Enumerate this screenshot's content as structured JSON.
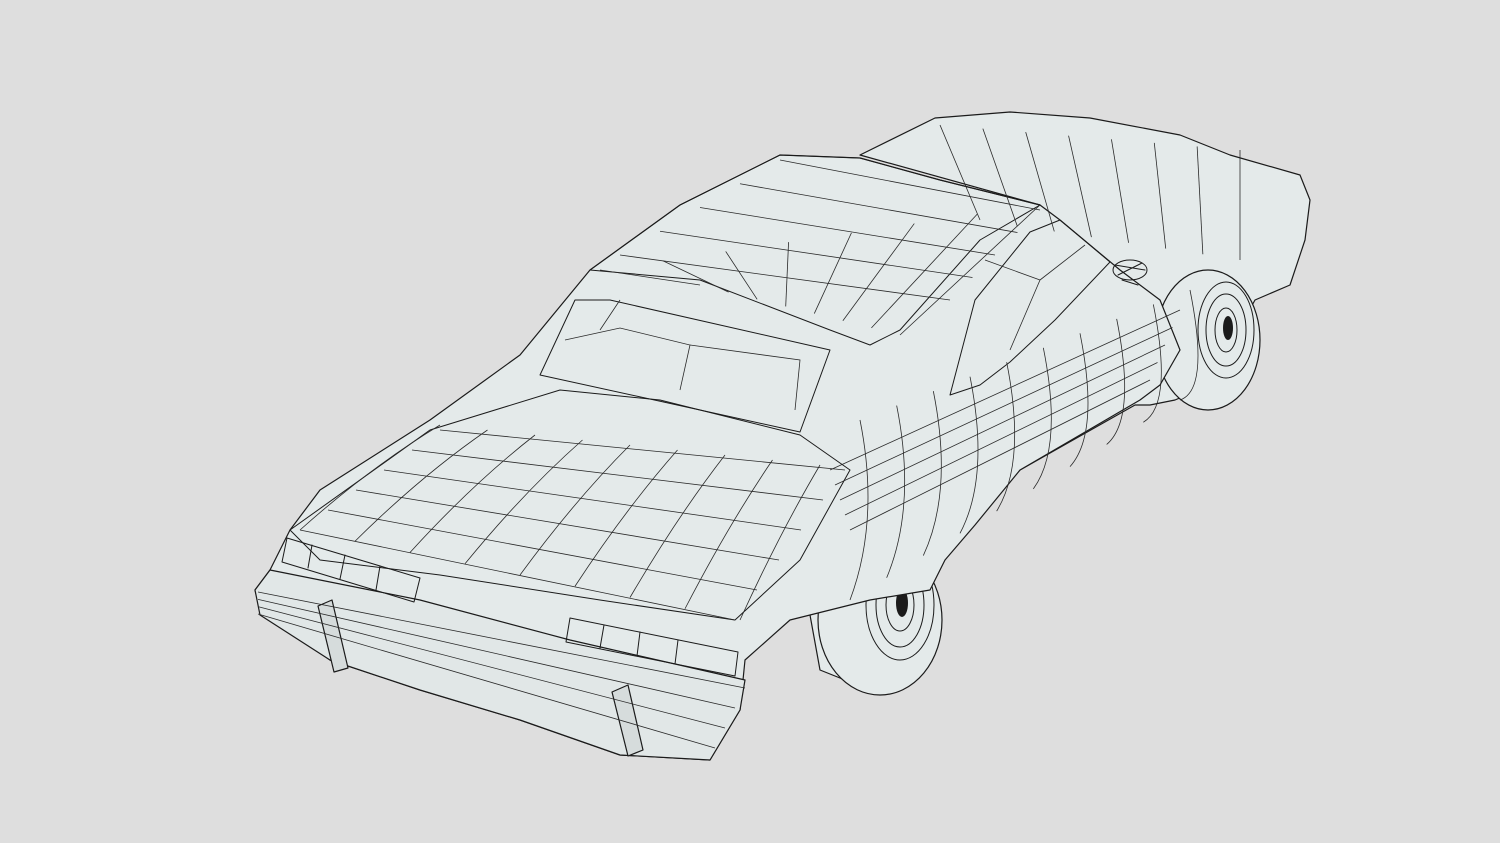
{
  "viewport": {
    "background": "#dedede",
    "surface_color": "#e4eaea",
    "glass_color": "#ffffff",
    "edge_color": "#1b1b1b"
  },
  "model": {
    "icon": "car-wireframe-icon"
  }
}
